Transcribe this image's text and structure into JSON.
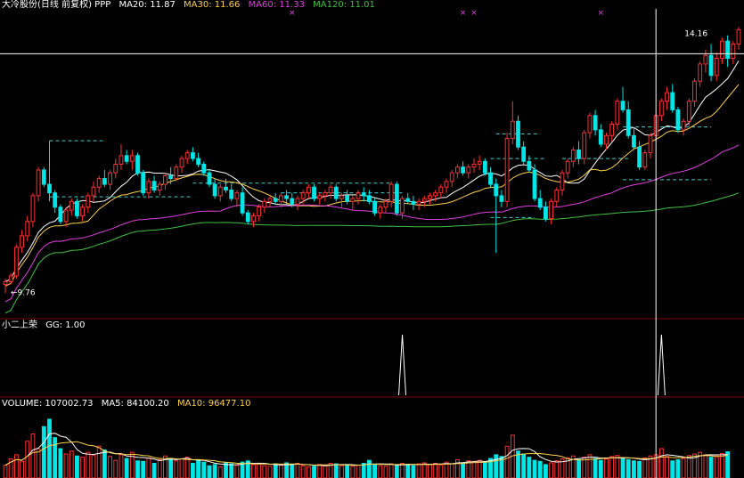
{
  "header": {
    "stock": "大冷股份(日线 前复权) PPP",
    "ma20": "MA20: 11.87",
    "ma30": "MA30: 11.66",
    "ma60": "MA60: 11.33",
    "ma120": "MA120: 11.01"
  },
  "indicator_panel": {
    "title": "小二上荣",
    "gg": "GG: 1.00"
  },
  "volume_panel": {
    "volume": "VOLUME: 107002.73",
    "ma5": "MA5: 84100.20",
    "ma10": "MA10: 96477.10"
  },
  "colors": {
    "up": "#ff3030",
    "down": "#00e5e5",
    "ma20": "#ffffff",
    "ma30": "#ffd24a",
    "ma60": "#e040e0",
    "ma120": "#40c040",
    "crosshair": "#ffffff",
    "divider": "#800000",
    "signal_line": "#ffffff",
    "dashed_level": "#40d0d0",
    "marker": "#e040e0"
  },
  "chart_data": {
    "type": "candlestick",
    "price_range": [
      9.3,
      14.6
    ],
    "high_label": "14.16",
    "low_label": "9.76",
    "crosshair_value": 13.88,
    "crosshair_index": 118,
    "dashed_levels": [
      {
        "price": 12.36,
        "from": 8,
        "to": 18
      },
      {
        "price": 11.38,
        "from": 8,
        "to": 34
      },
      {
        "price": 11.62,
        "from": 34,
        "to": 70
      },
      {
        "price": 11.45,
        "from": 50,
        "to": 72
      },
      {
        "price": 12.05,
        "from": 88,
        "to": 98
      },
      {
        "price": 12.48,
        "from": 89,
        "to": 97
      },
      {
        "price": 11.02,
        "from": 88,
        "to": 96
      },
      {
        "price": 12.6,
        "from": 112,
        "to": 128
      },
      {
        "price": 11.68,
        "from": 112,
        "to": 128
      },
      {
        "price": 12.05,
        "from": 101,
        "to": 113
      }
    ],
    "markers": [
      52,
      83,
      85,
      108,
      135
    ],
    "signals": [
      72,
      119
    ],
    "candles": [
      [
        9.85,
        9.95,
        9.7,
        9.9
      ],
      [
        9.9,
        10.05,
        9.85,
        10.0
      ],
      [
        10.0,
        10.55,
        9.95,
        10.5
      ],
      [
        10.5,
        10.8,
        10.4,
        10.7
      ],
      [
        10.7,
        11.05,
        10.6,
        10.95
      ],
      [
        10.95,
        11.45,
        10.85,
        11.4
      ],
      [
        11.4,
        11.9,
        11.3,
        11.85
      ],
      [
        11.85,
        11.9,
        11.55,
        11.6
      ],
      [
        11.6,
        12.36,
        11.3,
        11.45
      ],
      [
        11.45,
        11.5,
        11.1,
        11.2
      ],
      [
        11.2,
        11.25,
        10.9,
        10.95
      ],
      [
        10.95,
        11.2,
        10.85,
        11.15
      ],
      [
        11.15,
        11.35,
        11.05,
        11.3
      ],
      [
        11.3,
        11.35,
        11.0,
        11.05
      ],
      [
        11.05,
        11.25,
        10.95,
        11.2
      ],
      [
        11.2,
        11.45,
        11.1,
        11.4
      ],
      [
        11.4,
        11.65,
        11.3,
        11.55
      ],
      [
        11.55,
        11.75,
        11.45,
        11.7
      ],
      [
        11.7,
        11.85,
        11.55,
        11.6
      ],
      [
        11.6,
        11.85,
        11.5,
        11.8
      ],
      [
        11.8,
        12.05,
        11.7,
        11.95
      ],
      [
        11.95,
        12.3,
        11.85,
        12.1
      ],
      [
        12.1,
        12.2,
        11.95,
        12.0
      ],
      [
        12.0,
        12.2,
        11.85,
        12.1
      ],
      [
        12.1,
        12.15,
        11.75,
        11.8
      ],
      [
        11.8,
        11.85,
        11.4,
        11.45
      ],
      [
        11.45,
        11.7,
        11.35,
        11.65
      ],
      [
        11.65,
        11.75,
        11.45,
        11.5
      ],
      [
        11.5,
        11.65,
        11.4,
        11.6
      ],
      [
        11.6,
        11.8,
        11.5,
        11.75
      ],
      [
        11.75,
        11.9,
        11.6,
        11.7
      ],
      [
        11.7,
        11.95,
        11.65,
        11.9
      ],
      [
        11.9,
        12.1,
        11.8,
        12.05
      ],
      [
        12.05,
        12.2,
        11.95,
        12.15
      ],
      [
        12.15,
        12.25,
        12.0,
        12.05
      ],
      [
        12.05,
        12.15,
        11.9,
        11.95
      ],
      [
        11.95,
        12.0,
        11.75,
        11.8
      ],
      [
        11.8,
        11.85,
        11.55,
        11.6
      ],
      [
        11.6,
        11.7,
        11.35,
        11.4
      ],
      [
        11.4,
        11.6,
        11.3,
        11.55
      ],
      [
        11.55,
        11.7,
        11.45,
        11.5
      ],
      [
        11.5,
        11.6,
        11.3,
        11.35
      ],
      [
        11.35,
        11.5,
        11.2,
        11.45
      ],
      [
        11.45,
        11.55,
        11.05,
        11.1
      ],
      [
        11.1,
        11.15,
        10.9,
        10.95
      ],
      [
        10.95,
        11.1,
        10.85,
        11.05
      ],
      [
        11.05,
        11.25,
        10.95,
        11.2
      ],
      [
        11.2,
        11.35,
        11.1,
        11.3
      ],
      [
        11.3,
        11.4,
        11.2,
        11.35
      ],
      [
        11.35,
        11.45,
        11.25,
        11.3
      ],
      [
        11.3,
        11.45,
        11.2,
        11.4
      ],
      [
        11.4,
        11.5,
        11.25,
        11.35
      ],
      [
        11.35,
        11.45,
        11.2,
        11.25
      ],
      [
        11.25,
        11.4,
        11.15,
        11.35
      ],
      [
        11.35,
        11.5,
        11.25,
        11.45
      ],
      [
        11.45,
        11.6,
        11.35,
        11.55
      ],
      [
        11.55,
        11.6,
        11.3,
        11.35
      ],
      [
        11.35,
        11.45,
        11.25,
        11.4
      ],
      [
        11.4,
        11.5,
        11.3,
        11.45
      ],
      [
        11.45,
        11.6,
        11.35,
        11.55
      ],
      [
        11.55,
        11.6,
        11.3,
        11.35
      ],
      [
        11.35,
        11.45,
        11.2,
        11.4
      ],
      [
        11.4,
        11.5,
        11.25,
        11.3
      ],
      [
        11.3,
        11.4,
        11.15,
        11.35
      ],
      [
        11.35,
        11.5,
        11.25,
        11.45
      ],
      [
        11.45,
        11.55,
        11.3,
        11.4
      ],
      [
        11.4,
        11.5,
        11.25,
        11.3
      ],
      [
        11.3,
        11.35,
        11.05,
        11.1
      ],
      [
        11.1,
        11.25,
        11.0,
        11.2
      ],
      [
        11.2,
        11.35,
        11.1,
        11.3
      ],
      [
        11.3,
        11.65,
        11.2,
        11.6
      ],
      [
        11.6,
        11.65,
        11.05,
        11.1
      ],
      [
        11.1,
        11.4,
        11.0,
        11.35
      ],
      [
        11.35,
        11.45,
        11.25,
        11.3
      ],
      [
        11.3,
        11.4,
        11.15,
        11.25
      ],
      [
        11.25,
        11.35,
        11.15,
        11.3
      ],
      [
        11.3,
        11.4,
        11.2,
        11.35
      ],
      [
        11.35,
        11.45,
        11.25,
        11.4
      ],
      [
        11.4,
        11.5,
        11.3,
        11.45
      ],
      [
        11.45,
        11.6,
        11.35,
        11.55
      ],
      [
        11.55,
        11.7,
        11.45,
        11.65
      ],
      [
        11.65,
        11.85,
        11.55,
        11.8
      ],
      [
        11.8,
        11.95,
        11.7,
        11.9
      ],
      [
        11.9,
        12.0,
        11.75,
        11.8
      ],
      [
        11.8,
        11.95,
        11.7,
        11.9
      ],
      [
        11.9,
        12.05,
        11.8,
        11.95
      ],
      [
        11.95,
        12.1,
        11.85,
        12.0
      ],
      [
        12.0,
        12.05,
        11.75,
        11.8
      ],
      [
        11.8,
        11.9,
        11.55,
        11.6
      ],
      [
        11.6,
        11.7,
        10.4,
        11.4
      ],
      [
        11.4,
        11.5,
        11.2,
        11.3
      ],
      [
        11.3,
        12.5,
        11.2,
        12.4
      ],
      [
        12.4,
        13.05,
        12.3,
        12.7
      ],
      [
        12.7,
        12.8,
        12.2,
        12.25
      ],
      [
        12.25,
        12.35,
        11.95,
        12.0
      ],
      [
        12.0,
        12.1,
        11.8,
        11.85
      ],
      [
        11.85,
        11.95,
        11.3,
        11.35
      ],
      [
        11.35,
        11.5,
        11.15,
        11.2
      ],
      [
        11.2,
        11.3,
        10.95,
        11.0
      ],
      [
        11.0,
        11.35,
        10.9,
        11.3
      ],
      [
        11.3,
        11.55,
        11.2,
        11.5
      ],
      [
        11.5,
        11.85,
        11.4,
        11.8
      ],
      [
        11.8,
        12.05,
        11.7,
        12.0
      ],
      [
        12.0,
        12.25,
        11.9,
        12.2
      ],
      [
        12.2,
        12.35,
        11.95,
        12.05
      ],
      [
        12.05,
        12.55,
        11.95,
        12.5
      ],
      [
        12.5,
        12.85,
        12.4,
        12.8
      ],
      [
        12.8,
        12.9,
        12.45,
        12.55
      ],
      [
        12.55,
        12.65,
        12.25,
        12.3
      ],
      [
        12.3,
        12.5,
        12.2,
        12.45
      ],
      [
        12.45,
        12.7,
        12.35,
        12.65
      ],
      [
        12.65,
        13.1,
        12.55,
        13.05
      ],
      [
        13.05,
        13.3,
        12.85,
        12.9
      ],
      [
        12.9,
        13.05,
        12.4,
        12.45
      ],
      [
        12.45,
        12.6,
        12.2,
        12.25
      ],
      [
        12.25,
        12.35,
        11.85,
        11.9
      ],
      [
        11.9,
        12.2,
        11.85,
        12.15
      ],
      [
        12.15,
        12.5,
        12.05,
        12.45
      ],
      [
        12.45,
        12.85,
        12.35,
        12.8
      ],
      [
        12.8,
        13.1,
        12.7,
        13.05
      ],
      [
        13.05,
        13.3,
        12.9,
        13.2
      ],
      [
        13.2,
        13.35,
        12.85,
        12.9
      ],
      [
        12.9,
        12.95,
        12.5,
        12.55
      ],
      [
        12.55,
        12.75,
        12.45,
        12.7
      ],
      [
        12.7,
        13.1,
        12.6,
        13.05
      ],
      [
        13.05,
        13.45,
        12.95,
        13.4
      ],
      [
        13.4,
        13.75,
        13.3,
        13.7
      ],
      [
        13.7,
        13.95,
        13.55,
        13.85
      ],
      [
        13.85,
        14.05,
        13.4,
        13.5
      ],
      [
        13.5,
        13.9,
        13.4,
        13.8
      ],
      [
        13.8,
        14.16,
        13.7,
        14.1
      ],
      [
        14.1,
        14.2,
        13.65,
        13.8
      ],
      [
        13.8,
        14.1,
        13.7,
        14.05
      ],
      [
        14.05,
        14.35,
        13.95,
        14.3
      ]
    ],
    "volume_range": [
      0,
      280000
    ],
    "volumes": [
      52000,
      78000,
      95000,
      68000,
      150000,
      180000,
      120000,
      210000,
      240000,
      165000,
      120000,
      98000,
      110000,
      90000,
      85000,
      105000,
      92000,
      130000,
      115000,
      88000,
      72000,
      95000,
      80000,
      105000,
      70000,
      68000,
      82000,
      60000,
      75000,
      90000,
      80000,
      70000,
      78000,
      85000,
      60000,
      72000,
      65000,
      50000,
      55000,
      45000,
      62000,
      58000,
      52000,
      65000,
      70000,
      55000,
      60000,
      50000,
      48000,
      58000,
      52000,
      62000,
      55000,
      60000,
      50000,
      45000,
      48000,
      55000,
      52000,
      60000,
      58000,
      50000,
      55000,
      48000,
      52000,
      60000,
      72000,
      55000,
      50000,
      48000,
      58000,
      52000,
      60000,
      55000,
      50000,
      58000,
      62000,
      55000,
      60000,
      52000,
      65000,
      58000,
      75000,
      62000,
      70000,
      68000,
      72000,
      65000,
      80000,
      95000,
      88000,
      130000,
      175000,
      110000,
      98000,
      85000,
      72000,
      68000,
      55000,
      62000,
      70000,
      78000,
      82000,
      90000,
      75000,
      85000,
      95000,
      80000,
      72000,
      78000,
      88000,
      92000,
      80000,
      75000,
      70000,
      68000,
      82000,
      90000,
      95000,
      120000,
      88000,
      70000,
      75000,
      80000,
      92000,
      98000,
      105000,
      95000,
      85000,
      90000,
      100000,
      107002
    ],
    "vol_ma5": [],
    "vol_ma10": []
  }
}
